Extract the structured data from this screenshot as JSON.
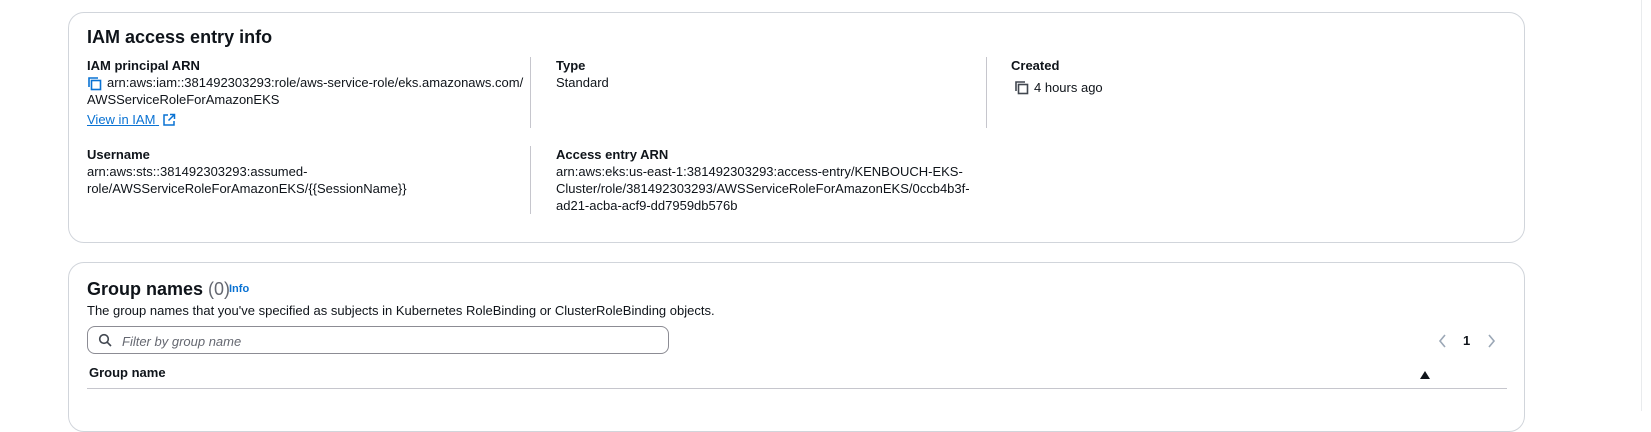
{
  "access_entry_info": {
    "title": "IAM access entry info",
    "iam_principal_arn": {
      "label": "IAM principal ARN",
      "value_line1": "arn:aws:iam::381492303293:role/aws-service-role/eks.amazonaws.com/",
      "value_line2": "AWSServiceRoleForAmazonEKS",
      "view_link": "View in IAM"
    },
    "type": {
      "label": "Type",
      "value": "Standard"
    },
    "created": {
      "label": "Created",
      "value": "4 hours ago"
    },
    "username": {
      "label": "Username",
      "value_line1": "arn:aws:sts::381492303293:assumed-",
      "value_line2": "role/AWSServiceRoleForAmazonEKS/{{SessionName}}"
    },
    "access_entry_arn": {
      "label": "Access entry ARN",
      "value_line1": "arn:aws:eks:us-east-1:381492303293:access-entry/KENBOUCH-EKS-",
      "value_line2": "Cluster/role/381492303293/AWSServiceRoleForAmazonEKS/0ccb4b3f-",
      "value_line3": "ad21-acba-acf9-dd7959db576b"
    }
  },
  "group_names": {
    "title": "Group names",
    "count": "(0)",
    "info": "Info",
    "description": "The group names that you've specified as subjects in Kubernetes RoleBinding or ClusterRoleBinding objects.",
    "search_placeholder": "Filter by group name",
    "page": "1",
    "column_header": "Group name"
  },
  "colors": {
    "link": "#0972d3",
    "border": "#d1d5db",
    "text": "#0f141a"
  },
  "icons": [
    "copy-icon",
    "external-link-icon",
    "search-icon",
    "chevron-left-icon",
    "chevron-right-icon",
    "sort-ascending-icon"
  ]
}
